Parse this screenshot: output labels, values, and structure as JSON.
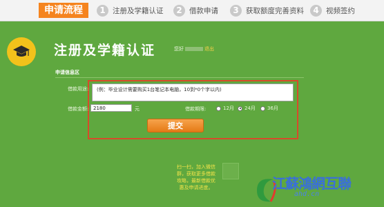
{
  "header": {
    "flow_title": "申请流程",
    "steps": [
      {
        "num": "1",
        "label": "注册及学籍认证"
      },
      {
        "num": "2",
        "label": "借款申请"
      },
      {
        "num": "3",
        "label": "获取额度完善资料"
      },
      {
        "num": "4",
        "label": "视频签约"
      }
    ]
  },
  "hero": {
    "title": "注册及学籍认证",
    "user_prefix": "您好",
    "logout": "退出"
  },
  "form": {
    "section_title": "申请信息区",
    "purpose_label": "借款用途:",
    "purpose_value": "(例：毕业设计需要购买1台笔记本电脑，10到*0个字以内)",
    "amount_label": "借款金额:",
    "amount_value": "2180",
    "amount_unit": "元",
    "term_label": "借款期限:",
    "term_options": [
      {
        "label": "12月",
        "selected": false
      },
      {
        "label": "24月",
        "selected": true
      },
      {
        "label": "36月",
        "selected": false
      }
    ],
    "submit_label": "提交"
  },
  "promo": {
    "text": "扫一扫，加入微信群，获取更多借款攻略，最新借款优惠及申请进度。"
  },
  "watermark": {
    "text": "江蘇鴻網互聯",
    "sub": "ahd.cn"
  },
  "colors": {
    "background": "#5fa83f",
    "accent": "#f5841f",
    "frame": "#d84a2a",
    "badge": "#f2c21b"
  }
}
